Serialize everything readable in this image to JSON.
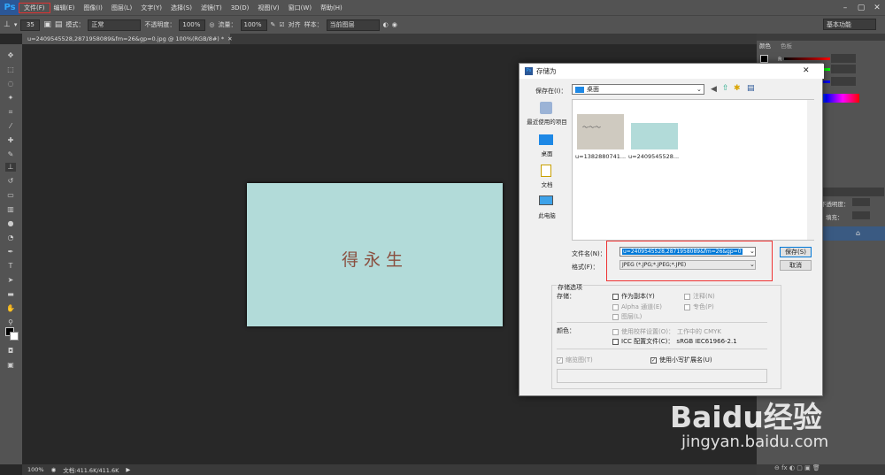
{
  "app": {
    "logo": "Ps"
  },
  "menu": [
    "文件(F)",
    "编辑(E)",
    "图像(I)",
    "图层(L)",
    "文字(Y)",
    "选择(S)",
    "滤镜(T)",
    "3D(D)",
    "视图(V)",
    "窗口(W)",
    "帮助(H)"
  ],
  "options": {
    "brush_size": "35",
    "mode_label": "模式：",
    "mode_value": "正常",
    "opacity_label": "不透明度：",
    "opacity_value": "100%",
    "flow_label": "流量：",
    "flow_value": "100%",
    "align_label": "对齐",
    "sample_label": "样本：",
    "sample_value": "当前图层",
    "workspace": "基本功能"
  },
  "document": {
    "tab_title": "u=2409545528,2871958089&fm=26&gp=0.jpg @ 100%(RGB/8#) *",
    "canvas_text": "得永生"
  },
  "status": {
    "zoom": "100%",
    "doc_info": "文档:411.6K/411.6K"
  },
  "panels": {
    "color_tab": "颜色",
    "swatches_tab": "色板",
    "r_label": "R",
    "opacity_label": "不透明度：",
    "fill_label": "填充："
  },
  "dialog": {
    "title": "存储为",
    "save_in_label": "保存在(I)：",
    "save_in_value": "桌面",
    "places": [
      "最近使用的项目",
      "桌面",
      "文档",
      "此电脑"
    ],
    "files": [
      "u=1382880741...",
      "u=2409545528..."
    ],
    "filename_label": "文件名(N)：",
    "filename_value": "u=2409545528,2871958089&fm=26&gp=0",
    "format_label": "格式(F)：",
    "format_value": "JPEG (*.JPG;*.JPEG;*.JPE)",
    "save_button": "保存(S)",
    "cancel_button": "取消",
    "options_title": "存储选项",
    "store_label": "存储：",
    "as_copy": "作为副本(Y)",
    "notes": "注释(N)",
    "alpha": "Alpha 通道(E)",
    "spot": "专色(P)",
    "layers": "图层(L)",
    "color_label": "颜色：",
    "use_proof": "使用校样设置(O)：",
    "proof_value": "工作中的 CMYK",
    "icc": "ICC 配置文件(C)：",
    "icc_value": "sRGB IEC61966-2.1",
    "thumbnail": "缩览图(T)",
    "lowercase_ext": "使用小写扩展名(U)"
  },
  "watermark": {
    "brand": "Baidu经验",
    "url": "jingyan.baidu.com"
  }
}
